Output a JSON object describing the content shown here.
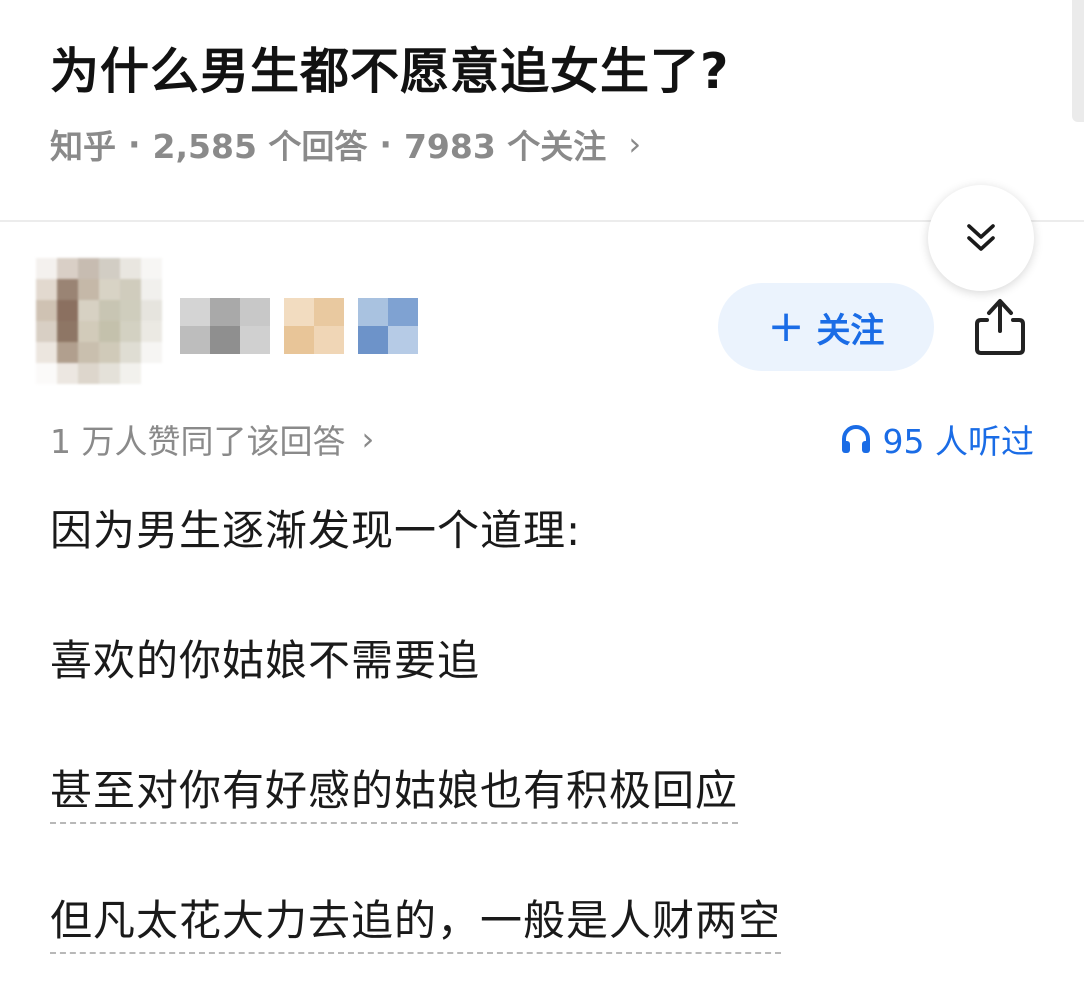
{
  "question": {
    "title": "为什么男生都不愿意追女生了?",
    "source": "知乎",
    "separator": "·",
    "answers_count": "2,585 个回答",
    "followers_count": "7983 个关注",
    "chevron": "›"
  },
  "controls": {
    "collapse_icon": "double-chevron-down-icon",
    "follow_plus": "+",
    "follow_label": "关注",
    "share_icon": "share-icon"
  },
  "answer": {
    "upvotes_text": "1 万人赞同了该回答",
    "upvotes_chevron": "›",
    "listen_icon": "headphones-icon",
    "listen_text": "95 人听过",
    "paragraphs": [
      "因为男生逐渐发现一个道理:",
      "喜欢的你姑娘不需要追",
      "甚至对你有好感的姑娘也有积极回应",
      "但凡太花大力去追的，一般是人财两空"
    ]
  },
  "colors": {
    "accent": "#1a6ce6",
    "follow_bg": "#ebf3fd",
    "meta_gray": "#8a8a8a",
    "text": "#1a1a1a"
  }
}
